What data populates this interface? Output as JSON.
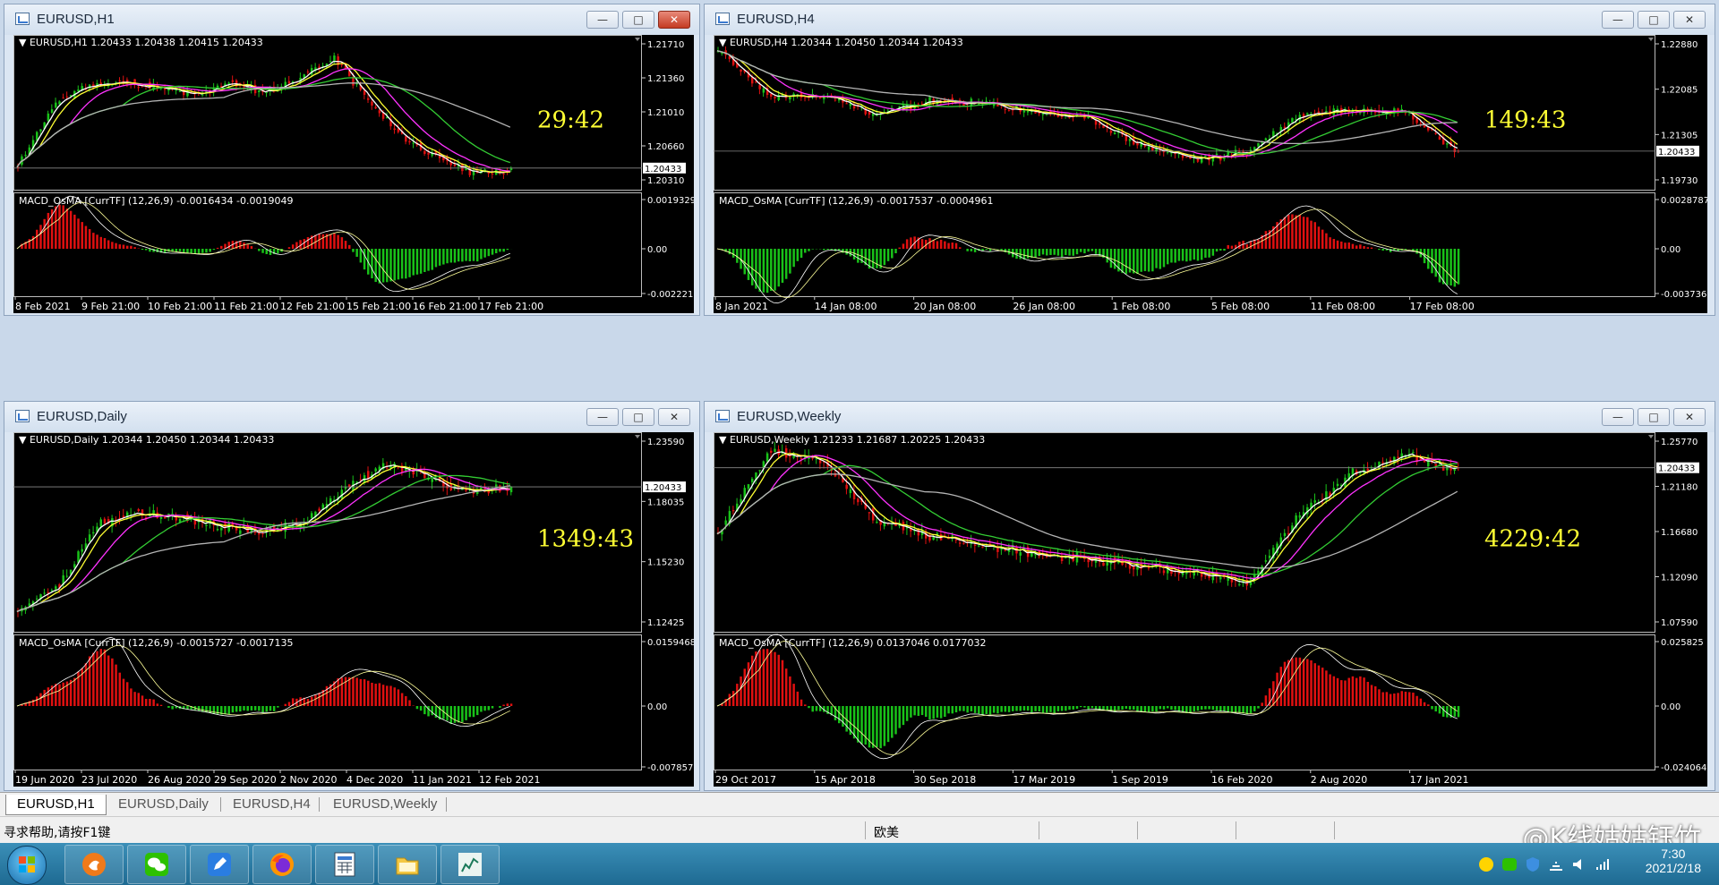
{
  "tabs": [
    "EURUSD,H1",
    "EURUSD,Daily",
    "EURUSD,H4",
    "EURUSD,Weekly"
  ],
  "active_tab": "EURUSD,H1",
  "status_left": "寻求帮助,请按F1键",
  "status_profile": "欧美",
  "clock_time": "7:30",
  "clock_date": "2021/2/18",
  "watermark": "@K线姑姑钰竹",
  "colors": {
    "bull": "#19c219",
    "bear": "#e01010",
    "ma_white": "#ffffff",
    "ma_yellow": "#ffff33",
    "ma_magenta": "#ff33ff",
    "ma_green": "#33cc33",
    "ma_gray": "#b4b4b4",
    "countdown": "#ffff33"
  },
  "windows": [
    {
      "title": "EURUSD,H1",
      "header": "EURUSD,H1  1.20433 1.20438 1.20415 1.20433",
      "countdown": "29:42",
      "current_price": "1.20433",
      "price_ticks": [
        "1.21710",
        "1.21360",
        "1.21010",
        "1.20660",
        "1.20310"
      ],
      "macd_header": "MACD_OsMA [CurrTF] (12,26,9) -0.0016434 -0.0019049",
      "macd_ticks": [
        "0.0019329",
        "0.00",
        "-0.0022215"
      ],
      "time_ticks": [
        "8 Feb 2021",
        "9 Feb 21:00",
        "10 Feb 21:00",
        "11 Feb 21:00",
        "12 Feb 21:00",
        "15 Feb 21:00",
        "16 Feb 21:00",
        "17 Feb 21:00"
      ]
    },
    {
      "title": "EURUSD,H4",
      "header": "EURUSD,H4  1.20344 1.20450 1.20344 1.20433",
      "countdown": "149:43",
      "current_price": "1.20433",
      "price_ticks": [
        "1.22880",
        "1.22085",
        "1.21305",
        "1.19730"
      ],
      "macd_header": "MACD_OsMA [CurrTF] (12,26,9) -0.0017537 -0.0004961",
      "macd_ticks": [
        "0.0028787",
        "0.00",
        "-0.0037361"
      ],
      "time_ticks": [
        "8 Jan 2021",
        "14 Jan 08:00",
        "20 Jan 08:00",
        "26 Jan 08:00",
        "1 Feb 08:00",
        "5 Feb 08:00",
        "11 Feb 08:00",
        "17 Feb 08:00"
      ]
    },
    {
      "title": "EURUSD,Daily",
      "header": "EURUSD,Daily  1.20344 1.20450 1.20344 1.20433",
      "countdown": "1349:43",
      "current_price": "1.20433",
      "price_ticks": [
        "1.23590",
        "1.18035",
        "1.15230",
        "1.12425"
      ],
      "macd_header": "MACD_OsMA [CurrTF] (12,26,9) -0.0015727 -0.0017135",
      "macd_ticks": [
        "0.0159468",
        "0.00",
        "-0.0078573"
      ],
      "time_ticks": [
        "19 Jun 2020",
        "23 Jul 2020",
        "26 Aug 2020",
        "29 Sep 2020",
        "2 Nov 2020",
        "4 Dec 2020",
        "11 Jan 2021",
        "12 Feb 2021"
      ]
    },
    {
      "title": "EURUSD,Weekly",
      "header": "EURUSD,Weekly  1.21233 1.21687 1.20225 1.20433",
      "countdown": "4229:42",
      "current_price": "1.20433",
      "price_ticks": [
        "1.25770",
        "1.21180",
        "1.16680",
        "1.12090",
        "1.07590"
      ],
      "macd_header": "MACD_OsMA [CurrTF] (12,26,9) 0.0137046 0.0177032",
      "macd_ticks": [
        "0.025825",
        "0.00",
        "-0.0240649"
      ],
      "time_ticks": [
        "29 Oct 2017",
        "15 Apr 2018",
        "30 Sep 2018",
        "17 Mar 2019",
        "1 Sep 2019",
        "16 Feb 2020",
        "2 Aug 2020",
        "17 Jan 2021"
      ]
    }
  ]
}
